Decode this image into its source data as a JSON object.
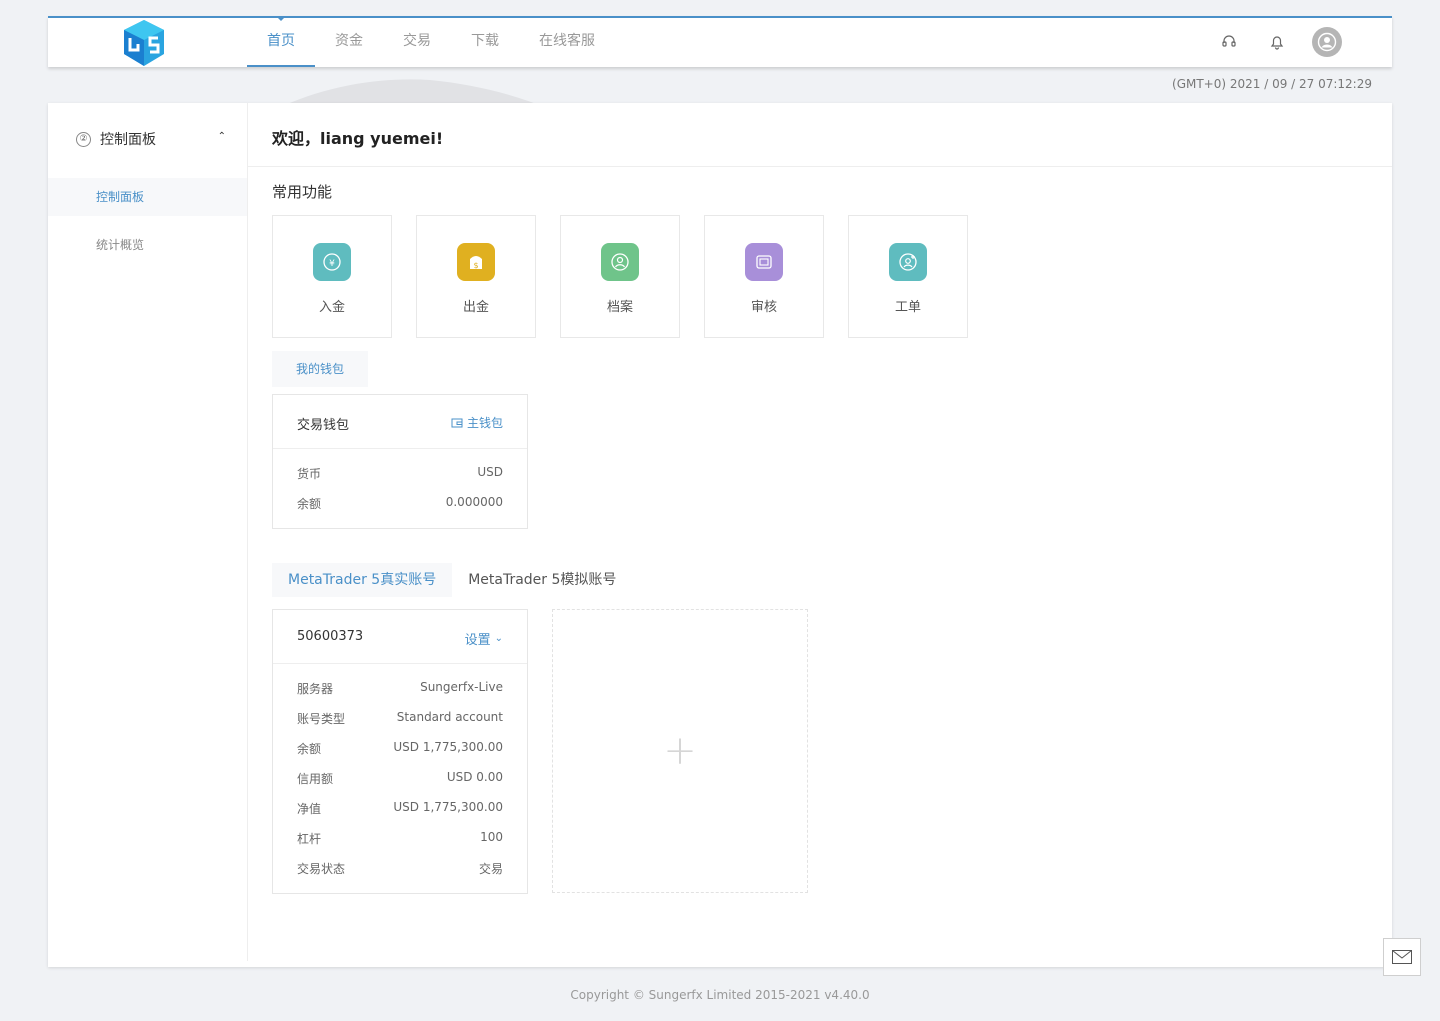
{
  "nav": {
    "items": [
      {
        "label": "首页",
        "active": true
      },
      {
        "label": "资金",
        "active": false
      },
      {
        "label": "交易",
        "active": false
      },
      {
        "label": "下载",
        "active": false
      },
      {
        "label": "在线客服",
        "active": false
      }
    ],
    "icons": [
      "support-icon",
      "bell-icon",
      "user-avatar-icon"
    ]
  },
  "datetime": "(GMT+0) 2021 / 09 / 27 07:12:29",
  "sidebar": {
    "header": "控制面板",
    "items": [
      {
        "label": "控制面板",
        "active": true
      },
      {
        "label": "统计概览",
        "active": false
      }
    ]
  },
  "welcome": "欢迎，liang yuemei!",
  "quick": {
    "title": "常用功能",
    "items": [
      {
        "label": "入金",
        "icon": "deposit-icon",
        "color": "#5fbcbf"
      },
      {
        "label": "出金",
        "icon": "withdraw-icon",
        "color": "#e0b020"
      },
      {
        "label": "档案",
        "icon": "profile-icon",
        "color": "#6fc48a"
      },
      {
        "label": "审核",
        "icon": "review-icon",
        "color": "#a88fd9"
      },
      {
        "label": "工单",
        "icon": "ticket-icon",
        "color": "#5fbcbf"
      }
    ]
  },
  "wallet": {
    "tab": "我的钱包",
    "title": "交易钱包",
    "action": "主钱包",
    "rows": [
      {
        "k": "货币",
        "v": "USD"
      },
      {
        "k": "余额",
        "v": "0.000000"
      }
    ]
  },
  "mt5": {
    "tabs": [
      {
        "label": "MetaTrader 5真实账号",
        "active": true
      },
      {
        "label": "MetaTrader 5模拟账号",
        "active": false
      }
    ],
    "account": {
      "id": "50600373",
      "action": "设置",
      "rows": [
        {
          "k": "服务器",
          "v": "Sungerfx-Live"
        },
        {
          "k": "账号类型",
          "v": "Standard account"
        },
        {
          "k": "余额",
          "v": "USD 1,775,300.00"
        },
        {
          "k": "信用额",
          "v": "USD 0.00"
        },
        {
          "k": "净值",
          "v": "USD 1,775,300.00"
        },
        {
          "k": "杠杆",
          "v": "100"
        },
        {
          "k": "交易状态",
          "v": "交易"
        }
      ]
    },
    "add": "+"
  },
  "footer": "Copyright © Sungerfx Limited 2015-2021 v4.40.0",
  "colors": {
    "accent": "#4a90c8"
  }
}
